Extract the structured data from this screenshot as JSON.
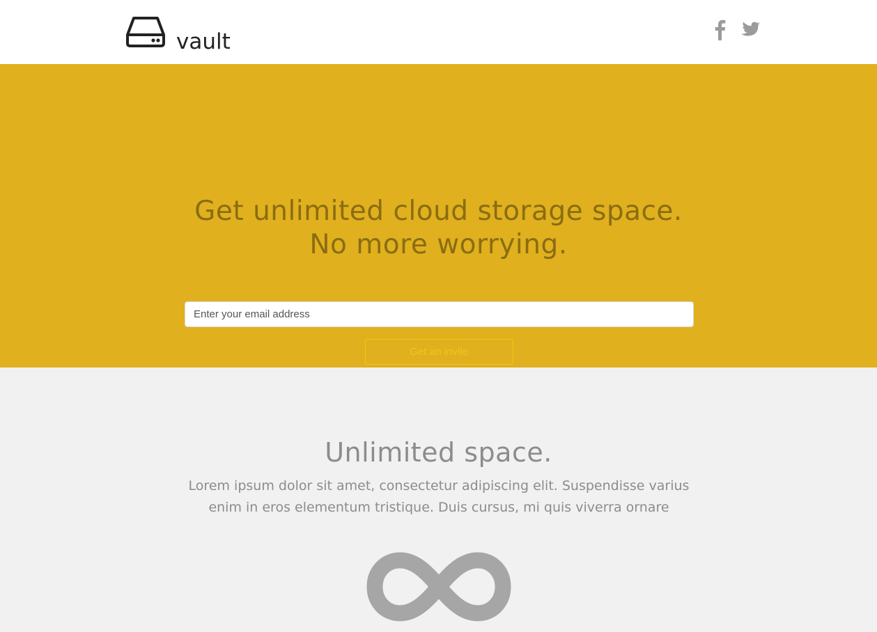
{
  "header": {
    "logo_text": "vault",
    "icons": [
      "hard-drive-icon",
      "facebook-icon",
      "twitter-icon"
    ]
  },
  "hero": {
    "title_line1": "Get unlimited cloud storage space.",
    "title_line2": "No more worrying.",
    "email_placeholder": "Enter your email address",
    "invite_label": "Get an invite"
  },
  "feature": {
    "title": "Unlimited space.",
    "text": "Lorem ipsum dolor sit amet, consectetur adipiscing elit. Suspendisse varius enim in eros elementum tristique. Duis cursus, mi quis viverra ornare",
    "icon": "infinity-icon"
  },
  "colors": {
    "hero_bg": "#e0b01e",
    "hero_text": "#8a6d12",
    "accent": "#f5c418",
    "muted_text": "#8c8c8c",
    "page_bg": "#f1f1f1"
  }
}
